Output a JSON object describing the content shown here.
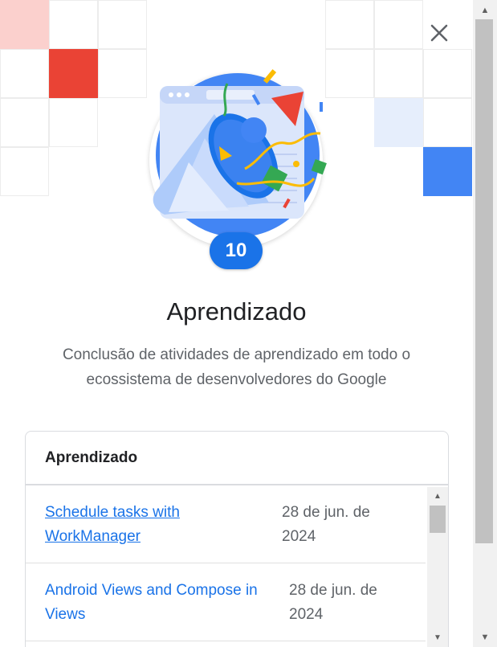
{
  "dialog": {
    "close_icon": "close-icon",
    "badge": {
      "count": "10",
      "illustration": "party-popper-icon",
      "colors": {
        "circle": "#4285f4",
        "count_bg": "#1a73e8",
        "confetti_red": "#ea4335",
        "confetti_yellow": "#fbbc04",
        "confetti_green": "#34a853"
      }
    },
    "title": "Aprendizado",
    "description": "Conclusão de atividades de aprendizado em todo o ecossistema de desenvolvedores do Google"
  },
  "card": {
    "header": "Aprendizado",
    "rows": [
      {
        "title": "Schedule tasks with WorkManager",
        "date": "28 de jun. de 2024"
      },
      {
        "title": "Android Views and Compose in Views",
        "date": "28 de jun. de 2024"
      }
    ]
  },
  "scrollbars": {
    "up_arrow": "▲",
    "down_arrow": "▼"
  },
  "colors": {
    "link": "#1a73e8",
    "accent_blue": "#4285f4",
    "accent_red": "#ea4335"
  }
}
